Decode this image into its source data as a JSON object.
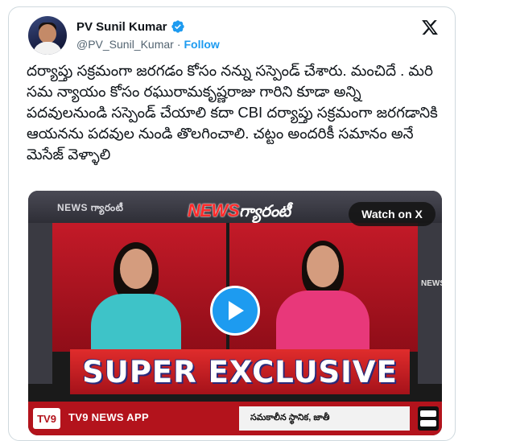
{
  "author": {
    "name": "PV Sunil Kumar",
    "handle": "@PV_Sunil_Kumar",
    "separator": "·",
    "follow_label": "Follow",
    "verified": true
  },
  "tweet": {
    "text": "దర్యాప్తు సక్రమంగా జరగడం కోసం నన్ను సస్పెండ్ చేశారు. మంచిదే . మరి సమ న్యాయం కోసం రఘురామకృష్ణరాజు గారిని కూడా అన్ని పదవులనుండి సస్పెండ్ చేయాలి కదా CBI దర్యాప్తు సక్రమంగా జరగడానికి ఆయనను పదవుల నుండి తొలగించాలి. చట్టం అందరికీ సమానం అనే మెసేజ్ వెళ్ళాలి"
  },
  "media": {
    "watch_label": "Watch on X",
    "news_left": "NEWS గ్యారంటీ",
    "news_logo_main": "NEWS",
    "news_logo_telugu": "గ్యారంటీ",
    "news_side": "NEWS",
    "banner": "SUPER EXCLUSIVE",
    "channel_badge": "TV9",
    "app_label": "TV9 NEWS APP",
    "ticker": "సమకాలీన స్థానిక, జాతీ"
  },
  "icons": {
    "verified": "verified-badge-icon",
    "x_logo": "x-logo-icon",
    "play": "play-icon"
  },
  "colors": {
    "accent": "#1d9bf0",
    "text": "#0f1419",
    "muted": "#536471",
    "banner_red": "#e02c2c"
  }
}
